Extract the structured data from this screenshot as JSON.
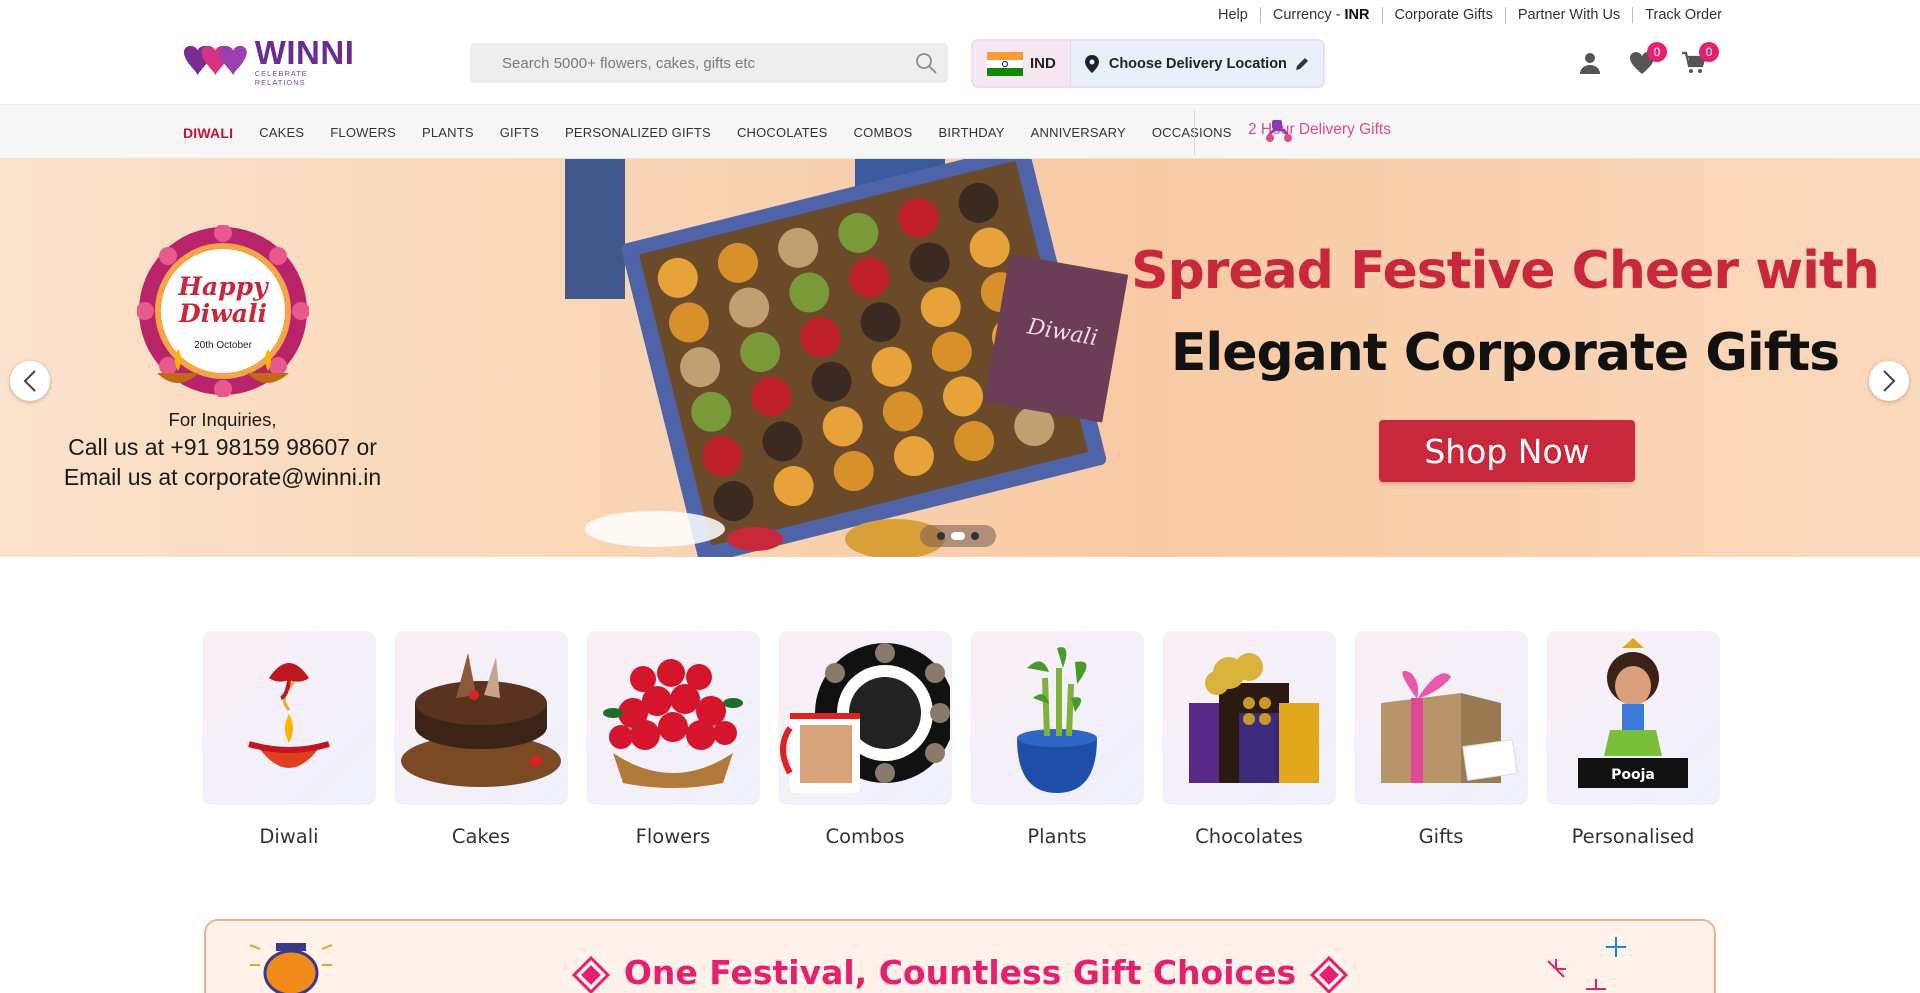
{
  "topbar": {
    "help": "Help",
    "currency_label": "Currency -",
    "currency_code": "INR",
    "corporate": "Corporate Gifts",
    "partner": "Partner With Us",
    "track": "Track Order"
  },
  "logo": {
    "word": "WINNI",
    "tagline": "CELEBRATE RELATIONS"
  },
  "search": {
    "placeholder": "Search 5000+ flowers, cakes, gifts etc"
  },
  "location": {
    "country_code": "IND",
    "label": "Choose Delivery Location"
  },
  "header_icons": {
    "wishlist_count": "0",
    "cart_count": "0"
  },
  "nav": {
    "items": [
      "DIWALI",
      "CAKES",
      "FLOWERS",
      "PLANTS",
      "GIFTS",
      "PERSONALIZED GIFTS",
      "CHOCOLATES",
      "COMBOS",
      "BIRTHDAY",
      "ANNIVERSARY",
      "OCCASIONS"
    ],
    "express": "2 Hour Delivery Gifts"
  },
  "banner": {
    "badge_line1": "Happy",
    "badge_line2": "Diwali",
    "badge_date": "20th October",
    "inquiry_l1": "For Inquiries,",
    "inquiry_l2": "Call us at +91 98159 98607 or",
    "inquiry_l3": "Email us at corporate@winni.in",
    "card_text": "Diwali",
    "headline1": "Spread Festive Cheer with",
    "headline2": "Elegant Corporate Gifts",
    "cta": "Shop Now",
    "slides": 3,
    "active_slide": 2
  },
  "categories": [
    {
      "label": "Diwali",
      "icon": "diya-ganesha-icon"
    },
    {
      "label": "Cakes",
      "icon": "cake-icon"
    },
    {
      "label": "Flowers",
      "icon": "rose-bouquet-icon"
    },
    {
      "label": "Combos",
      "icon": "mug-clock-icon"
    },
    {
      "label": "Plants",
      "icon": "bamboo-plant-icon"
    },
    {
      "label": "Chocolates",
      "icon": "chocolate-box-icon"
    },
    {
      "label": "Gifts",
      "icon": "gift-box-icon"
    },
    {
      "label": "Personalised",
      "icon": "caricature-icon"
    }
  ],
  "personalised_name": "Pooja",
  "festival": {
    "title": "One Festival, Countless Gift Choices"
  },
  "colors": {
    "brand_purple": "#6a2c91",
    "accent_pink": "#e5206f",
    "accent_red": "#c8283c"
  }
}
